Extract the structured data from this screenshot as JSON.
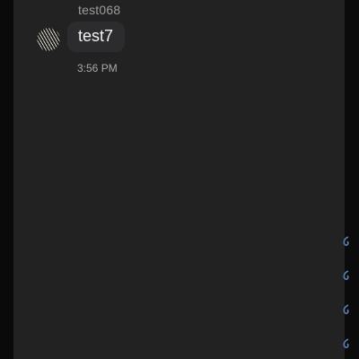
{
  "message": {
    "sender": "test068",
    "text": "test7",
    "time": "3:56 PM"
  },
  "icons": {
    "avatar": "user-avatar-icon",
    "reaction": "link-icon"
  },
  "colors": {
    "panel": "#222222",
    "bubble": "#2c2c2e",
    "reaction": "#5b7fb4"
  }
}
